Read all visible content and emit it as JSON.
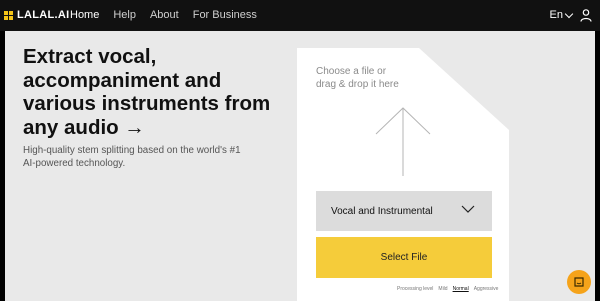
{
  "brand": {
    "name": "LALAL.AI"
  },
  "nav": {
    "items": [
      {
        "label": "Home"
      },
      {
        "label": "Help"
      },
      {
        "label": "About"
      },
      {
        "label": "For Business"
      }
    ]
  },
  "header": {
    "language": "En"
  },
  "hero": {
    "title": "Extract vocal, accompaniment and various instruments from any audio →",
    "subtitle": "High-quality stem splitting based on the world's #1 AI-powered technology."
  },
  "upload": {
    "drop_text_1": "Choose a file or",
    "drop_text_2": "drag & drop it here",
    "stem_select": "Vocal and Instrumental",
    "select_button": "Select File",
    "processing_level_label": "Processing level",
    "levels": [
      "Mild",
      "Normal",
      "Aggressive"
    ],
    "selected_level": "Normal"
  },
  "colors": {
    "accent": "#f5cc3a",
    "chat": "#f5a31a",
    "topbar": "#111111",
    "background": "#e9e9e9"
  },
  "icons": {
    "user": "user-icon",
    "chat": "chat-icon",
    "language_dropdown": "chevron-down-icon",
    "upload": "arrow-up-icon"
  }
}
